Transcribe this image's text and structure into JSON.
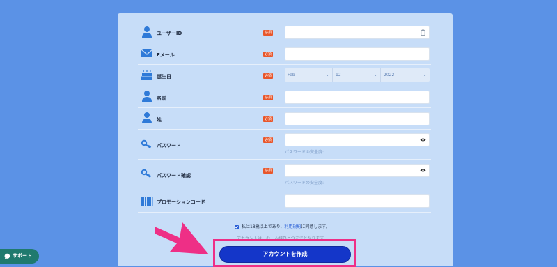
{
  "form": {
    "required_label": "必須",
    "fields": {
      "user_id": {
        "label": "ユーザーID"
      },
      "email": {
        "label": "Eメール"
      },
      "birthday": {
        "label": "誕生日",
        "month": "Feb",
        "day": "12",
        "year": "2022"
      },
      "first_name": {
        "label": "名前"
      },
      "last_name": {
        "label": "姓"
      },
      "password": {
        "label": "パスワード",
        "strength_label": "パスワードの安全度:"
      },
      "password_confirm": {
        "label": "パスワード確認",
        "strength_label": "パスワードの安全度:"
      },
      "promo_code": {
        "label": "プロモーションコード"
      }
    },
    "agreement": {
      "text_before": "私は18歳以上であり、",
      "terms_link": "利用規約",
      "text_after": "に同意します。"
    },
    "note": "アカウントは、お一人様ひとつまでとなります",
    "submit_label": "アカウントを作成"
  },
  "support": {
    "label": "サポート"
  },
  "colors": {
    "background": "#5b92e6",
    "panel": "#c7ddf8",
    "required_badge": "#e8562b",
    "submit_button": "#1436c9",
    "highlight_frame": "#ee2f86",
    "support_button": "#1f7a6e"
  }
}
